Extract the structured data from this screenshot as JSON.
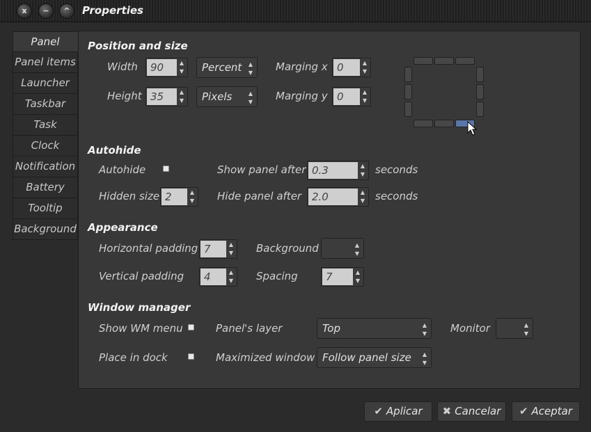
{
  "window": {
    "title": "Properties",
    "controls": [
      "x",
      "−",
      "^"
    ]
  },
  "tabs": [
    {
      "label": "Panel",
      "active": true
    },
    {
      "label": "Panel items"
    },
    {
      "label": "Launcher"
    },
    {
      "label": "Taskbar"
    },
    {
      "label": "Task"
    },
    {
      "label": "Clock"
    },
    {
      "label": "Notification"
    },
    {
      "label": "Battery"
    },
    {
      "label": "Tooltip"
    },
    {
      "label": "Background"
    }
  ],
  "position": {
    "section": "Position and size",
    "width_label": "Width",
    "width_value": "90",
    "width_unit": "Percent",
    "height_label": "Height",
    "height_value": "35",
    "height_unit": "Pixels",
    "marging_x_label": "Marging x",
    "marging_x_value": "0",
    "marging_y_label": "Marging y",
    "marging_y_value": "0",
    "selected_position": "bottom-right"
  },
  "autohide": {
    "section": "Autohide",
    "autohide_label": "Autohide",
    "show_after_label": "Show panel after",
    "show_after_value": "0.3",
    "show_after_unit": "seconds",
    "hidden_size_label": "Hidden size",
    "hidden_size_value": "2",
    "hide_after_label": "Hide panel after",
    "hide_after_value": "2.0",
    "hide_after_unit": "seconds"
  },
  "appearance": {
    "section": "Appearance",
    "hpad_label": "Horizontal padding",
    "hpad_value": "7",
    "background_label": "Background",
    "background_value": "",
    "vpad_label": "Vertical padding",
    "vpad_value": "4",
    "spacing_label": "Spacing",
    "spacing_value": "7"
  },
  "wm": {
    "section": "Window manager",
    "show_menu_label": "Show WM menu",
    "layer_label": "Panel's layer",
    "layer_value": "Top",
    "monitor_label": "Monitor",
    "monitor_value": "",
    "dock_label": "Place in dock",
    "maximized_label": "Maximized window",
    "maximized_value": "Follow panel size"
  },
  "buttons": {
    "apply": "Aplicar",
    "cancel": "Cancelar",
    "ok": "Aceptar"
  },
  "colors": {
    "accent": "#5a75a8",
    "background": "#383838"
  }
}
